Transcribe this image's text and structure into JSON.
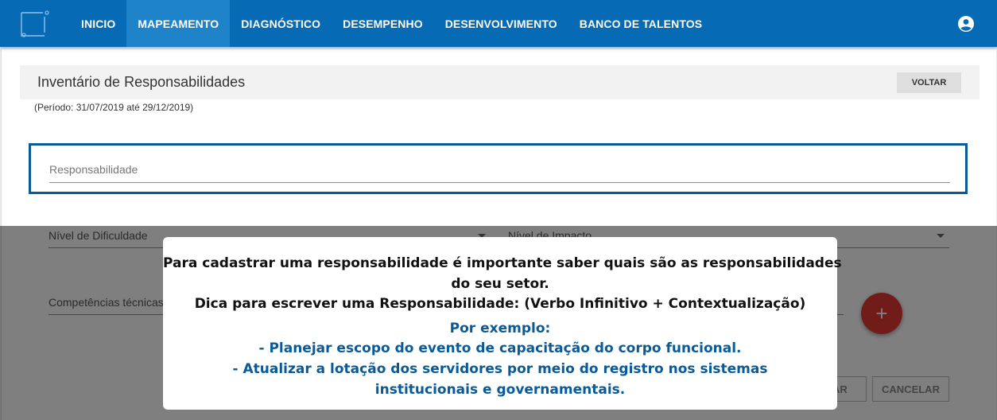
{
  "navbar": {
    "logo_icon": "logo-icon",
    "items": [
      {
        "label": "INICIO",
        "active": false
      },
      {
        "label": "MAPEAMENTO",
        "active": true
      },
      {
        "label": "DIAGNÓSTICO",
        "active": false
      },
      {
        "label": "DESEMPENHO",
        "active": false
      },
      {
        "label": "DESENVOLVIMENTO",
        "active": false
      },
      {
        "label": "BANCO DE TALENTOS",
        "active": false
      }
    ],
    "user_icon": "account-circle-icon",
    "color": "#066ab4"
  },
  "page": {
    "title": "Inventário de Responsabilidades",
    "back_label": "VOLTAR",
    "period": "(Período: 31/07/2019 até 29/12/2019)"
  },
  "form": {
    "responsibility_label": "Responsabilidade",
    "difficulty_label": "Nível de Dificuldade",
    "impact_label": "Nível de Impacto",
    "competencies_label": "Competências técnicas",
    "add_icon": "plus-icon",
    "add_label": "+",
    "save_label": "SALVAR",
    "cancel_label": "CANCELAR"
  },
  "dialog": {
    "line1": "Para cadastrar uma responsabilidade é importante saber quais são as responsabilidades",
    "line2": "do seu setor.",
    "line3": "Dica para escrever uma Responsabilidade: (Verbo Infinitivo + Contextualização)",
    "example_title": "Por exemplo:",
    "example1": "- Planejar escopo do evento de capacitação do corpo funcional.",
    "example2a": "- Atualizar a lotação dos servidores por meio do registro nos sistemas",
    "example2b": "institucionais e governamentais."
  }
}
